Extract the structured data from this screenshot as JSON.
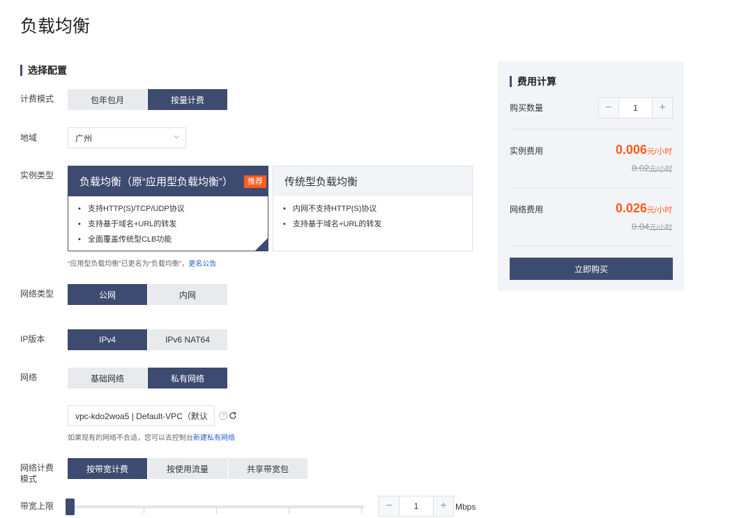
{
  "page_title": "负载均衡",
  "config": {
    "section_title": "选择配置",
    "billing_mode": {
      "label": "计费模式",
      "options": [
        "包年包月",
        "按量计费"
      ],
      "selected": "按量计费"
    },
    "region": {
      "label": "地域",
      "value": "广州"
    },
    "instance_type": {
      "label": "实例类型",
      "cards": [
        {
          "title": "负载均衡（原“应用型负载均衡”）",
          "badge": "推荐",
          "features": [
            "支持HTTP(S)/TCP/UDP协议",
            "支持基于域名+URL的转发",
            "全面覆盖传统型CLB功能"
          ],
          "selected": true
        },
        {
          "title": "传统型负载均衡",
          "features": [
            "内网不支持HTTP(S)协议",
            "支持基于域名+URL的转发"
          ],
          "selected": false
        }
      ],
      "note": "“应用型负载均衡”已更名为“负载均衡”，",
      "note_link": "更名公告"
    },
    "network_type": {
      "label": "网络类型",
      "options": [
        "公网",
        "内网"
      ],
      "selected": "公网"
    },
    "ip_version": {
      "label": "IP版本",
      "options": [
        "IPv4",
        "IPv6 NAT64"
      ],
      "selected": "IPv4"
    },
    "network": {
      "label": "网络",
      "options": [
        "基础网络",
        "私有网络"
      ],
      "selected": "私有网络",
      "vpc_value": "vpc-kdo2woa5 | Default-VPC（默认",
      "hint": "如果现有的网络不合适，您可以去控制台",
      "hint_link": "新建私有网络"
    },
    "network_billing": {
      "label_line1": "网络计费",
      "label_line2": "模式",
      "options": [
        "按带宽计费",
        "按使用流量",
        "共享带宽包"
      ],
      "selected": "按带宽计费"
    },
    "bandwidth": {
      "label": "带宽上限",
      "value": "1",
      "unit": "Mbps",
      "slider_fraction": 0.0
    }
  },
  "cost": {
    "title": "费用计算",
    "quantity_label": "购买数量",
    "quantity": "1",
    "instance_label": "实例费用",
    "instance_price": "0.006",
    "instance_unit": "元/小时",
    "instance_old_price": "0.02",
    "instance_old_unit": "元/小时",
    "network_label": "网络费用",
    "network_price": "0.026",
    "network_unit": "元/小时",
    "network_old_price": "0.04",
    "network_old_unit": "元/小时",
    "buy_label": "立即购买"
  },
  "colors": {
    "accent": "#3e4b70",
    "price": "#ff5c1f",
    "link": "#2a5bd7"
  },
  "icons": {
    "stepper_minus": "minus-icon",
    "stepper_plus": "plus-icon",
    "help": "question-circle-icon",
    "refresh": "refresh-icon",
    "check": "check-icon",
    "dropdown": "chevron-down-icon"
  }
}
